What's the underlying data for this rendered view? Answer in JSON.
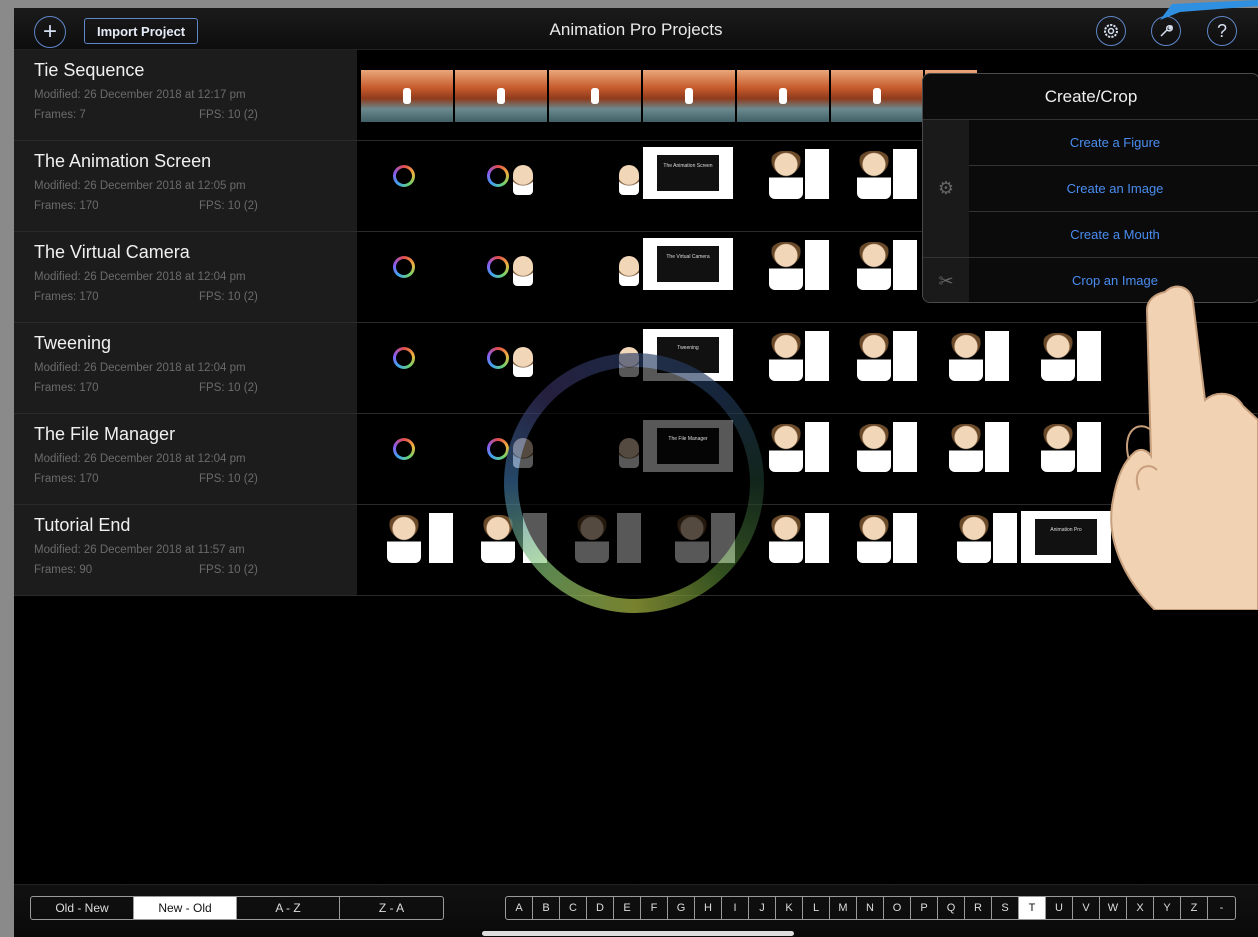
{
  "header": {
    "title": "Animation Pro Projects",
    "add_label": "+",
    "import_label": "Import Project",
    "help_label": "?"
  },
  "projects": [
    {
      "name": "Tie Sequence",
      "modified": "Modified: 26 December 2018 at 12:17 pm",
      "frames": "Frames: 7",
      "fps": "FPS: 10 (2)"
    },
    {
      "name": "The Animation Screen",
      "modified": "Modified: 26 December 2018 at 12:05 pm",
      "frames": "Frames: 170",
      "fps": "FPS: 10 (2)"
    },
    {
      "name": "The Virtual Camera",
      "modified": "Modified: 26 December 2018 at 12:04 pm",
      "frames": "Frames: 170",
      "fps": "FPS: 10 (2)"
    },
    {
      "name": "Tweening",
      "modified": "Modified: 26 December 2018 at 12:04 pm",
      "frames": "Frames: 170",
      "fps": "FPS: 10 (2)"
    },
    {
      "name": "The File Manager",
      "modified": "Modified: 26 December 2018 at 12:04 pm",
      "frames": "Frames: 170",
      "fps": "FPS: 10 (2)"
    },
    {
      "name": "Tutorial End",
      "modified": "Modified: 26 December 2018 at 11:57 am",
      "frames": "Frames: 90",
      "fps": "FPS: 10 (2)"
    }
  ],
  "slides": {
    "animation_screen": "The Animation Screen",
    "virtual_camera": "The Virtual Camera",
    "tweening": "Tweening",
    "file_manager": "The File Manager",
    "tutorial_end": "Animation Pro"
  },
  "popover": {
    "title": "Create/Crop",
    "items": [
      "Create a Figure",
      "Create an Image",
      "Create a Mouth",
      "Crop an Image"
    ]
  },
  "sort": {
    "options": [
      "Old - New",
      "New - Old",
      "A - Z",
      "Z - A"
    ],
    "selected": "New - Old"
  },
  "alphabet": {
    "letters": [
      "A",
      "B",
      "C",
      "D",
      "E",
      "F",
      "G",
      "H",
      "I",
      "J",
      "K",
      "L",
      "M",
      "N",
      "O",
      "P",
      "Q",
      "R",
      "S",
      "T",
      "U",
      "V",
      "W",
      "X",
      "Y",
      "Z",
      "-"
    ],
    "selected": "T"
  },
  "colors": {
    "accent": "#4a8df0",
    "button_border": "#5f86c7"
  }
}
